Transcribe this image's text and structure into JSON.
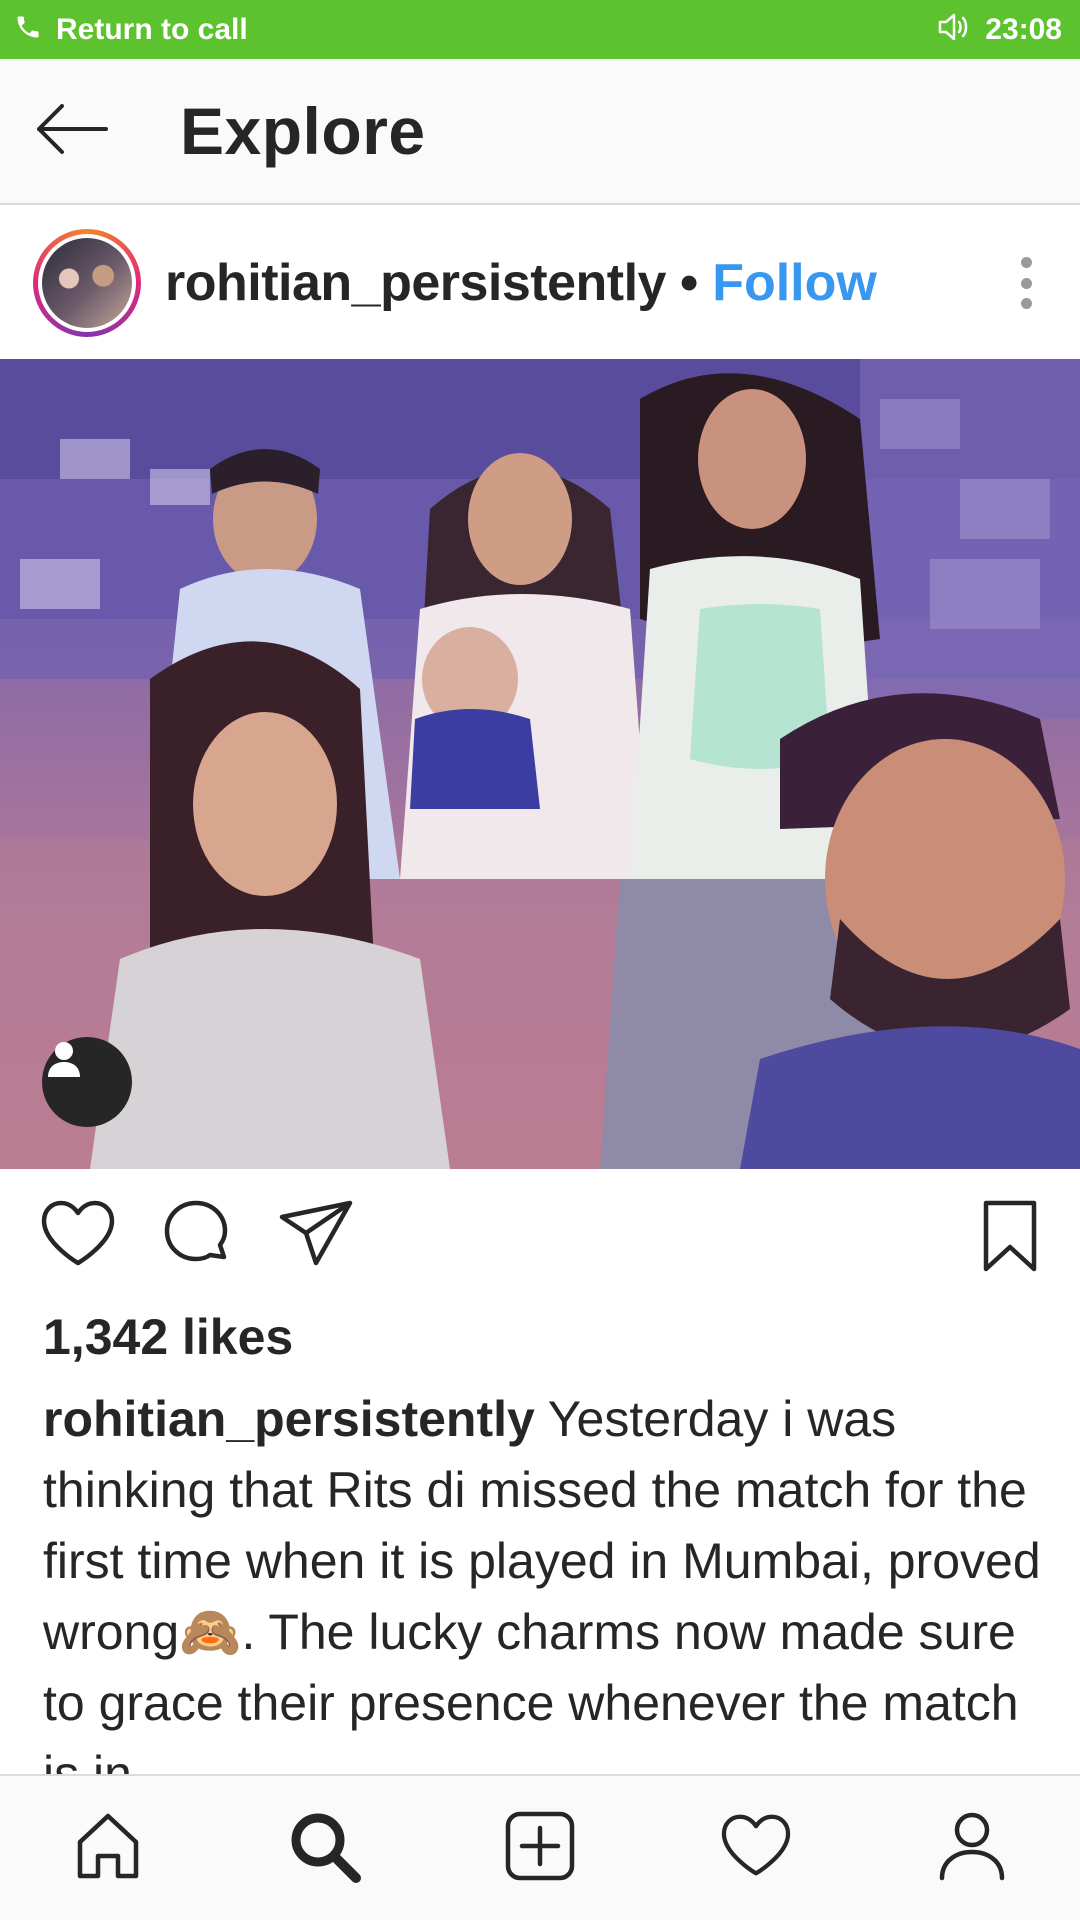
{
  "call_bar": {
    "label": "Return to call",
    "time": "23:08",
    "background": "#5cc22e",
    "icons": [
      "phone-icon",
      "speaker-icon"
    ]
  },
  "header": {
    "title": "Explore",
    "back_icon": "arrow-left-icon"
  },
  "post": {
    "username": "rohitian_persistently",
    "separator": "•",
    "follow_label": "Follow",
    "follow_color": "#3897f0",
    "more_icon": "vertical-dots-icon",
    "tag_icon": "person-tag-icon",
    "likes": "1,342 likes",
    "caption_user": "rohitian_persistently",
    "caption_text": "Yesterday i was thinking that Rits di missed the match for the first time when it is played in Mumbai, proved wrong🙈. The lucky charms now made sure to grace their presence whenever the match is in",
    "action_icons": [
      "heart-icon",
      "comment-icon",
      "share-icon",
      "bookmark-icon"
    ]
  },
  "bottom_nav": {
    "items": [
      "home-icon",
      "search-icon",
      "add-post-icon",
      "activity-heart-icon",
      "profile-icon"
    ],
    "active": "search-icon"
  }
}
